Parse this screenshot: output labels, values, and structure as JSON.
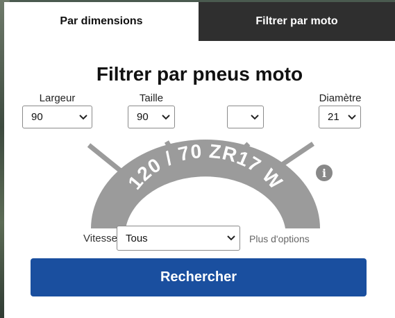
{
  "tabs": {
    "dimensions": "Par dimensions",
    "moto": "Filtrer par moto"
  },
  "title": "Filtrer par pneus moto",
  "fields": {
    "largeur": {
      "label": "Largeur",
      "value": "90"
    },
    "taille": {
      "label": "Taille",
      "value": "90"
    },
    "construction": {
      "label": "",
      "value": ""
    },
    "diametre": {
      "label": "Diamètre",
      "value": "21"
    }
  },
  "tire_marking": "120 / 70 ZR17 W",
  "vitesse": {
    "label": "Vitesse",
    "value": "Tous"
  },
  "more_options": "Plus d'options",
  "search_button": "Rechercher",
  "icons": {
    "info": "info-icon",
    "dropdown": "chevron-down-icon"
  },
  "colors": {
    "button": "#1a4f9f",
    "inactive_tab": "#2f2f2f",
    "tire": "#9b9b9b"
  }
}
